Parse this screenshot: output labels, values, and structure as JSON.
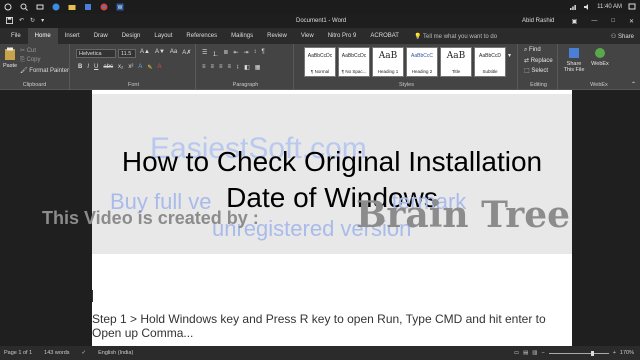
{
  "taskbar": {
    "time": "11:40 AM",
    "icons": [
      "search-icon",
      "task-view-icon",
      "edge-icon",
      "folder-icon",
      "store-icon",
      "word-icon"
    ]
  },
  "titlebar": {
    "document_title": "Document1 - Word",
    "user_name": "Abid Rashid",
    "window_controls": [
      "minimize-icon",
      "maximize-icon",
      "close-icon"
    ]
  },
  "ribbon_tabs": {
    "items": [
      "File",
      "Home",
      "Insert",
      "Draw",
      "Design",
      "Layout",
      "References",
      "Mailings",
      "Review",
      "View",
      "Nitro Pro 9",
      "ACROBAT"
    ],
    "active": "Home",
    "tell_me": "Tell me what you want to do",
    "share": "Share"
  },
  "ribbon": {
    "clipboard": {
      "paste": "Paste",
      "cut": "Cut",
      "copy": "Copy",
      "format_painter": "Format Painter",
      "label": "Clipboard"
    },
    "font": {
      "family": "Helvetica",
      "size": "11.5",
      "label": "Font",
      "buttons": [
        "B",
        "I",
        "U",
        "abc",
        "x₂",
        "x²"
      ]
    },
    "paragraph": {
      "label": "Paragraph"
    },
    "styles": {
      "label": "Styles",
      "items": [
        {
          "sample": "AaBbCcDc",
          "name": "¶ Normal"
        },
        {
          "sample": "AaBbCcDc",
          "name": "¶ No Spac..."
        },
        {
          "sample": "AaB",
          "name": "Heading 1"
        },
        {
          "sample": "AaBbCcC",
          "name": "Heading 2"
        },
        {
          "sample": "AaB",
          "name": "Title"
        },
        {
          "sample": "AaBbCcD",
          "name": "Subtitle"
        }
      ]
    },
    "editing": {
      "find": "Find",
      "replace": "Replace",
      "select": "Select",
      "label": "Editing"
    },
    "share_file": {
      "line1": "Share",
      "line2": "This File",
      "label": "WebEx"
    },
    "webex": "WebEx"
  },
  "document": {
    "watermark_site": "EasiestSoft.com",
    "watermark_buy_left": "Buy full ve",
    "watermark_buy_right": "termark",
    "watermark_unregistered": "unregistered version",
    "title_line1": "How to Check Original Installation",
    "title_line2": "Date of Windows",
    "overlay_left": "This Video is created by :",
    "overlay_right": "Brain Tree",
    "step_text": "Step 1 > Hold Windows key and Press R key to open Run, Type CMD and hit enter to Open up Comma..."
  },
  "statusbar": {
    "page": "Page 1 of 1",
    "words": "143 words",
    "language": "English (India)",
    "zoom": "170%",
    "zoom_level": 0.7
  }
}
